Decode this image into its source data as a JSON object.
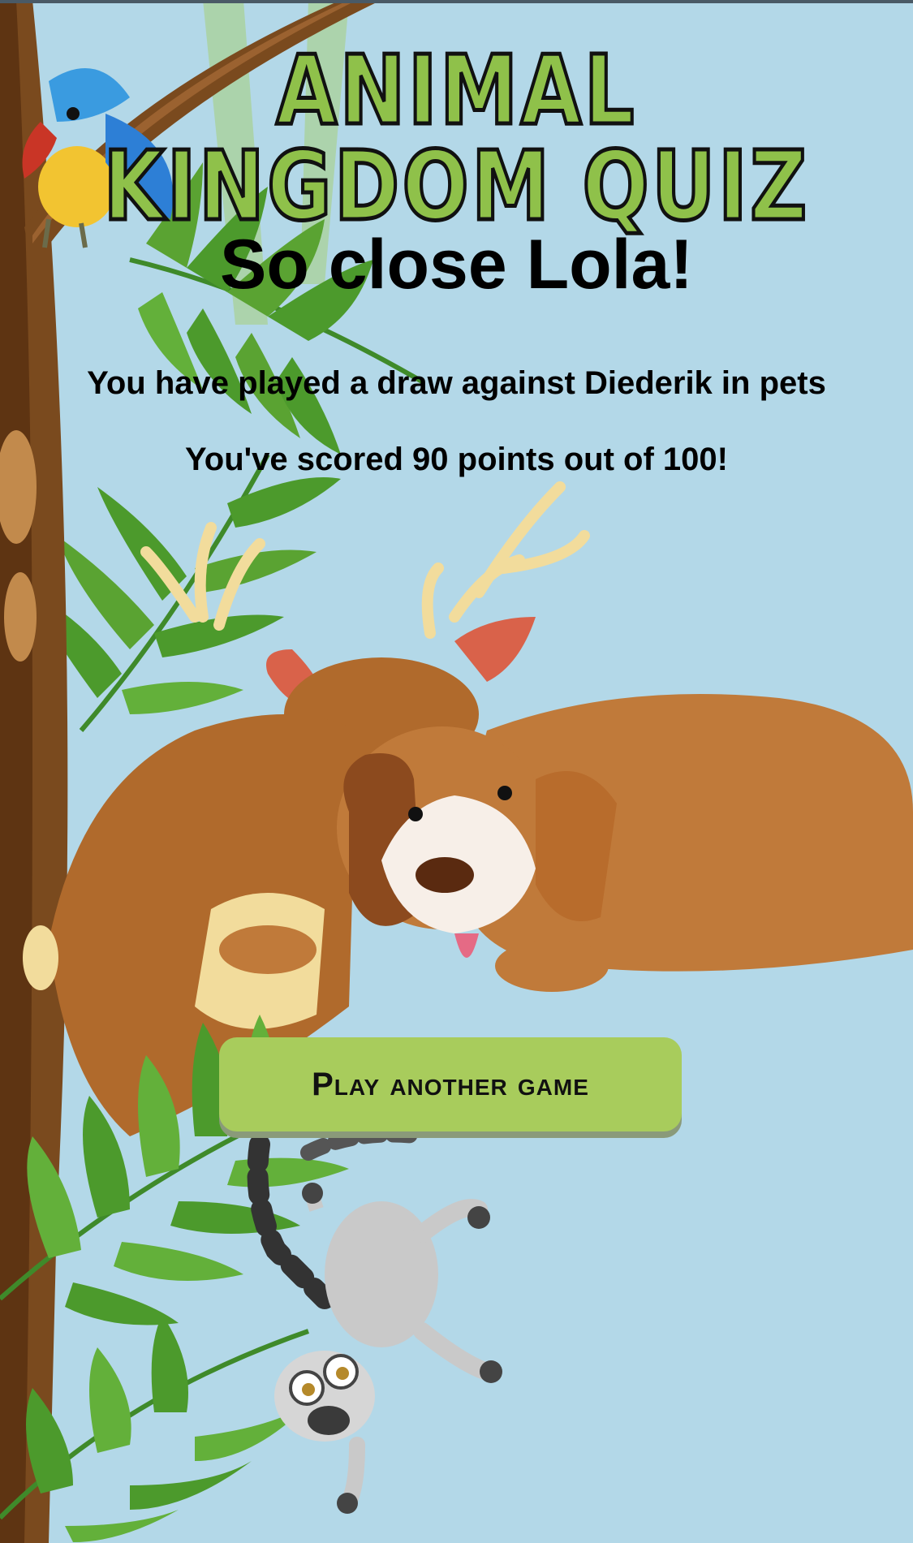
{
  "header": {
    "title": "ANIMAL KINGDOM QUIZ"
  },
  "result": {
    "headline": "So close Lola!",
    "draw_message": "You have played a draw against Diederik in pets",
    "score_message": "You've scored 90 points out of 100!"
  },
  "actions": {
    "play_again_label": "Play another game"
  },
  "illustrations": [
    "tree-icon",
    "palm-leaves-icon",
    "parrot-icon",
    "deer-icon",
    "dog-icon",
    "lemur-icon"
  ],
  "colors": {
    "background": "#b3d8e8",
    "title_fill": "#8fc14a",
    "button": "#a8cc5c",
    "text": "#000000"
  }
}
